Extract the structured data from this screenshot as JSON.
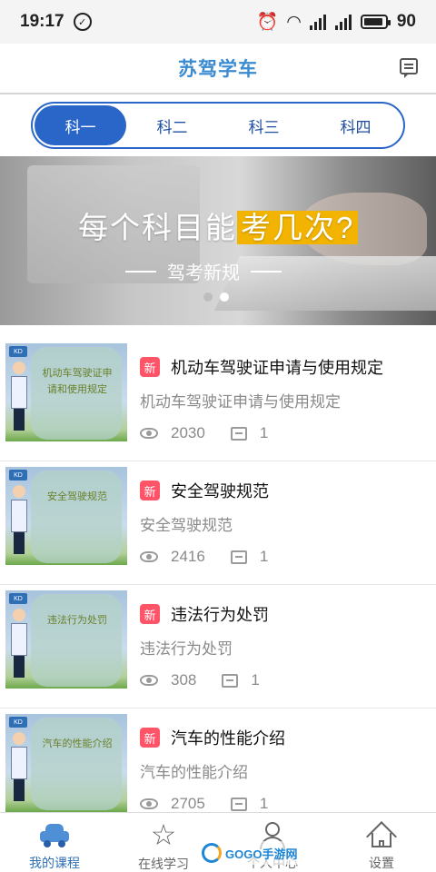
{
  "status_bar": {
    "time": "19:17",
    "network": "4G",
    "battery": "90",
    "battery_level": 0.9
  },
  "header": {
    "title": "苏驾学车"
  },
  "tabs": [
    {
      "label": "科一",
      "active": true
    },
    {
      "label": "科二",
      "active": false
    },
    {
      "label": "科三",
      "active": false
    },
    {
      "label": "科四",
      "active": false
    }
  ],
  "banner": {
    "headline_part1": "每个科目能",
    "headline_highlight": "考几次?",
    "subtitle": "驾考新规",
    "slides": 2,
    "active_slide": 2
  },
  "courses": [
    {
      "badge": "新",
      "title": "机动车驾驶证申请与使用规定",
      "subtitle": "机动车驾驶证申请与使用规定",
      "views": "2030",
      "comments": "1",
      "thumb_text": "机动车驾驶证申请和使用规定"
    },
    {
      "badge": "新",
      "title": "安全驾驶规范",
      "subtitle": "安全驾驶规范",
      "views": "2416",
      "comments": "1",
      "thumb_text": "安全驾驶规范"
    },
    {
      "badge": "新",
      "title": "违法行为处罚",
      "subtitle": "违法行为处罚",
      "views": "308",
      "comments": "1",
      "thumb_text": "违法行为处罚"
    },
    {
      "badge": "新",
      "title": "汽车的性能介绍",
      "subtitle": "汽车的性能介绍",
      "views": "2705",
      "comments": "1",
      "thumb_text": "汽车的性能介绍"
    }
  ],
  "tabbar": [
    {
      "label": "我的课程",
      "icon": "car-icon",
      "active": true
    },
    {
      "label": "在线学习",
      "icon": "star-icon",
      "active": false
    },
    {
      "label": "个人中心",
      "icon": "person-icon",
      "active": false
    },
    {
      "label": "设置",
      "icon": "home-icon",
      "active": false
    }
  ],
  "watermark": {
    "brand": "GOGO手游网",
    "url": "www.gogo.com"
  },
  "colors": {
    "accent": "#2a66c8",
    "title_blue": "#3b8bd0",
    "badge_red": "#ff5367",
    "tabbar_active": "#2f6fb6"
  }
}
